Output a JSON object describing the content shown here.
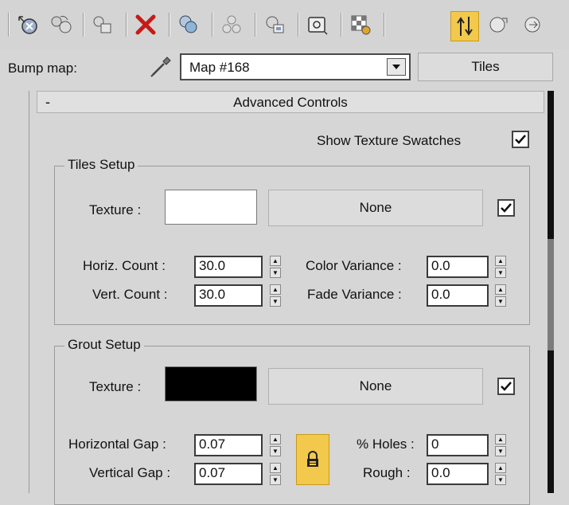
{
  "toolbar": {
    "icons": [
      "get-material-icon",
      "put-to-scene-icon",
      "assign-material-icon",
      "delete-icon",
      "make-unique-icon",
      "put-to-library-icon",
      "material-id-icon",
      "show-map-icon",
      "show-background-icon",
      "show-end-result-icon",
      "go-to-parent-icon",
      "go-forward-icon"
    ],
    "accent_color": "#f2c94c"
  },
  "bump": {
    "label": "Bump map:",
    "map_name": "Map #168",
    "map_type": "Tiles"
  },
  "rollout": {
    "collapse_symbol": "-",
    "title": "Advanced Controls",
    "show_swatches_label": "Show Texture Swatches",
    "show_swatches_checked": true
  },
  "tiles_setup": {
    "title": "Tiles Setup",
    "texture_label": "Texture :",
    "texture_color": "#ffffff",
    "texture_map": "None",
    "texture_enabled": true,
    "horiz_count_label": "Horiz. Count :",
    "horiz_count": "30.0",
    "vert_count_label": "Vert. Count :",
    "vert_count": "30.0",
    "color_variance_label": "Color Variance :",
    "color_variance": "0.0",
    "fade_variance_label": "Fade Variance :",
    "fade_variance": "0.0"
  },
  "grout_setup": {
    "title": "Grout Setup",
    "texture_label": "Texture :",
    "texture_color": "#000000",
    "texture_map": "None",
    "texture_enabled": true,
    "horizontal_gap_label": "Horizontal Gap :",
    "horizontal_gap": "0.07",
    "vertical_gap_label": "Vertical Gap :",
    "vertical_gap": "0.07",
    "holes_label": "% Holes :",
    "holes": "0",
    "rough_label": "Rough :",
    "rough": "0.0"
  }
}
